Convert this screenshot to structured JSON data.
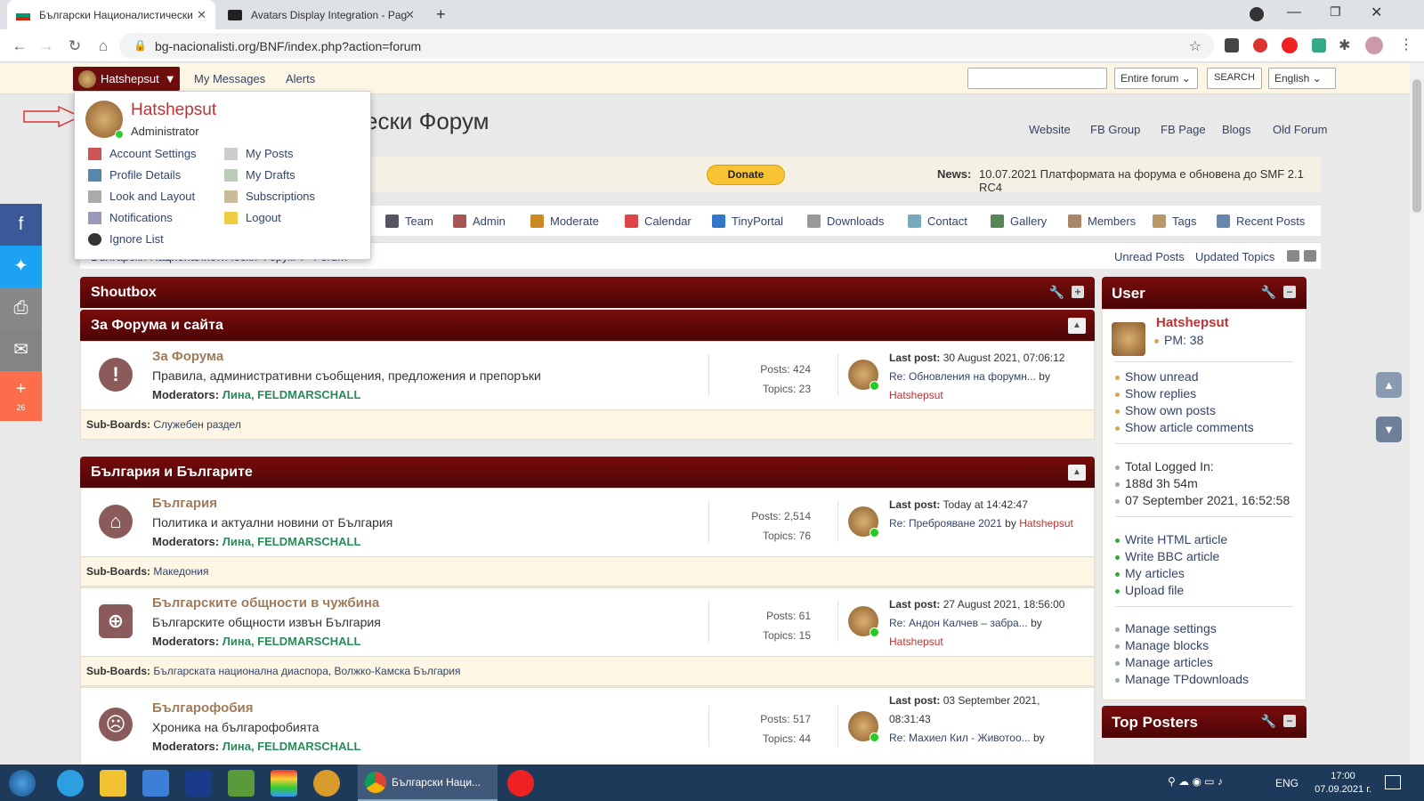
{
  "browser": {
    "tabs": [
      {
        "label": "Български Националистически"
      },
      {
        "label": "Avatars Display Integration - Pag"
      }
    ],
    "url": "bg-nacionalisti.org/BNF/index.php?action=forum",
    "new_tab": "+"
  },
  "topbar": {
    "user_button": "Hatshepsut",
    "my_messages": "My Messages",
    "alerts": "Alerts",
    "search_scope": "Entire forum",
    "search_button": "SEARCH",
    "language": "English"
  },
  "header": {
    "forum_title_partial": "ески Форум",
    "links": [
      "Website",
      "FB Group",
      "FB Page",
      "Blogs",
      "Old Forum"
    ]
  },
  "news": {
    "donate": "Donate",
    "label": "News:",
    "text": "10.07.2021 Платформата на форума е обновена до SMF 2.1 RC4"
  },
  "nav": {
    "items": [
      "Team",
      "Admin",
      "Moderate",
      "Calendar",
      "TinyPortal",
      "Downloads",
      "Contact",
      "Gallery",
      "Members",
      "Tags",
      "Recent Posts"
    ]
  },
  "breadcrumb": {
    "text": "Български Националистически Форум ► Forum",
    "unread": "Unread Posts",
    "updated": "Updated Topics"
  },
  "dropdown": {
    "name": "Hatshepsut",
    "role": "Administrator",
    "left": [
      "Account Settings",
      "Profile Details",
      "Look and Layout",
      "Notifications",
      "Ignore List"
    ],
    "right": [
      "My Posts",
      "My Drafts",
      "Subscriptions",
      "Logout"
    ]
  },
  "shoutbox": {
    "title": "Shoutbox"
  },
  "categories": [
    {
      "title": "За Форума и сайта"
    },
    {
      "title": "България и Българите"
    }
  ],
  "boards": [
    {
      "title": "За Форума",
      "desc": "Правила, административни съобщения, предложения и препоръки",
      "mods_label": "Moderators:",
      "mods": "Лина, FELDMARSCHALL",
      "posts": "Posts: 424",
      "topics": "Topics: 23",
      "last_label": "Last post:",
      "last_date": "30 August 2021, 07:06:12",
      "last_topic": "Re: Обновления на форумн...",
      "by": "by",
      "last_user": "Hatshepsut",
      "subs_label": "Sub-Boards:",
      "subs": "Служебен раздел"
    },
    {
      "title": "България",
      "desc": "Политика и актуални новини от България",
      "mods_label": "Moderators:",
      "mods": "Лина, FELDMARSCHALL",
      "posts": "Posts: 2,514",
      "topics": "Topics: 76",
      "last_label": "Last post:",
      "last_date": "Today at 14:42:47",
      "last_topic": "Re: Преброяване 2021",
      "by": "by",
      "last_user": "Hatshepsut",
      "subs_label": "Sub-Boards:",
      "subs": "Македония"
    },
    {
      "title": "Българските общности в чужбина",
      "desc": "Българските общности извън България",
      "mods_label": "Moderators:",
      "mods": "Лина, FELDMARSCHALL",
      "posts": "Posts: 61",
      "topics": "Topics: 15",
      "last_label": "Last post:",
      "last_date": "27 August 2021, 18:56:00",
      "last_topic": "Re: Андон Калчев – забра...",
      "by": "by",
      "last_user": "Hatshepsut",
      "subs_label": "Sub-Boards:",
      "subs": "Българската национална диаспора, Волжко-Камска България"
    },
    {
      "title": "Българофобия",
      "desc": "Хроника на българофобията",
      "mods_label": "Moderators:",
      "mods": "Лина, FELDMARSCHALL",
      "posts": "Posts: 517",
      "topics": "Topics: 44",
      "last_label": "Last post:",
      "last_date": "03 September 2021,",
      "last_date2": "08:31:43",
      "last_topic": "Re: Махиел Кил - Животоо...",
      "by": "by"
    }
  ],
  "user_panel": {
    "title": "User",
    "name": "Hatshepsut",
    "pm": "PM: 38",
    "links1": [
      "Show unread",
      "Show replies",
      "Show own posts",
      "Show article comments"
    ],
    "logged": [
      "Total Logged In:",
      "188d 3h 54m",
      "07 September 2021, 16:52:58"
    ],
    "links2": [
      "Write HTML article",
      "Write BBC article",
      "My articles",
      "Upload file"
    ],
    "links3": [
      "Manage settings",
      "Manage blocks",
      "Manage articles",
      "Manage TPdownloads"
    ]
  },
  "top_posters": {
    "title": "Top Posters"
  },
  "share": {
    "count": "26"
  },
  "taskbar": {
    "chrome_label": "Български Наци...",
    "lang": "ENG",
    "time": "17:00",
    "date": "07.09.2021 г."
  },
  "colors": {
    "accent": "#6e0d0d",
    "link": "#334466",
    "mods": "#2a8a5a"
  }
}
